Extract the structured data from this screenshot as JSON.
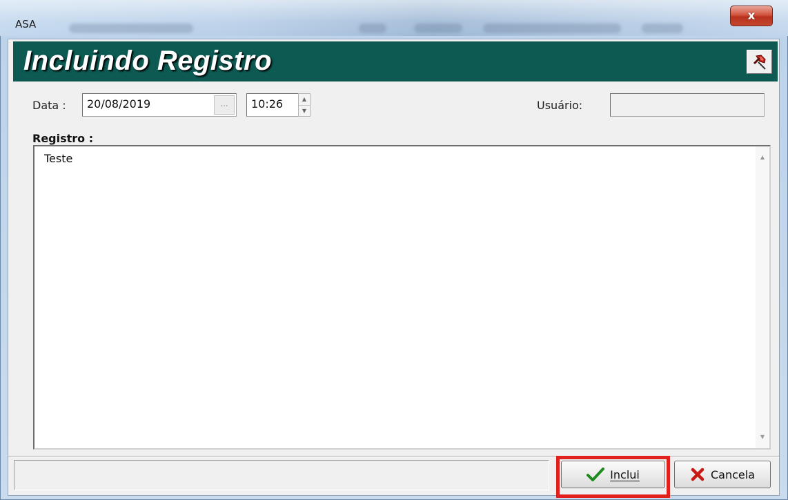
{
  "window": {
    "title": "ASA",
    "close_glyph": "x"
  },
  "header": {
    "title": "Incluindo Registro",
    "pin_icon": "pushpin-icon",
    "band_color": "#0d5a52"
  },
  "form": {
    "data_label": "Data :",
    "date_value": "20/08/2019",
    "date_button_label": "...",
    "time_value": "10:26",
    "usuario_label": "Usuário:",
    "usuario_value": "",
    "registro_label": "Registro :",
    "registro_text": "Teste"
  },
  "footer": {
    "inclui_label": "Inclui",
    "inclui_icon": "checkmark-icon",
    "cancela_label": "Cancela",
    "cancela_icon": "x-mark-icon",
    "highlight_color": "#e0201c"
  }
}
